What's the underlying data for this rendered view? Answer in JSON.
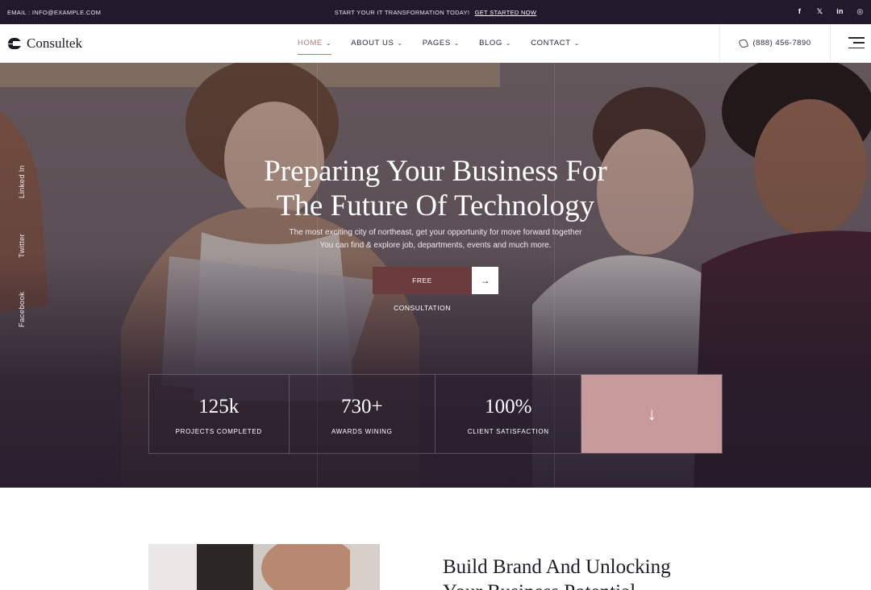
{
  "topbar": {
    "email": "EMAIL : INFO@EXAMPLE.COM",
    "promo": "START YOUR IT TRANSFORMATION TODAY!",
    "promo_link": "GET STARTED NOW",
    "social": [
      {
        "icon": "facebook-icon",
        "glyph": "f"
      },
      {
        "icon": "x-icon",
        "glyph": "𝕏"
      },
      {
        "icon": "linkedin-icon",
        "glyph": "in"
      },
      {
        "icon": "instagram-icon",
        "glyph": "◎"
      }
    ]
  },
  "nav": {
    "logo_text": "Consultek",
    "items": [
      {
        "label": "HOME",
        "active": true
      },
      {
        "label": "ABOUT US"
      },
      {
        "label": "PAGES"
      },
      {
        "label": "BLOG"
      },
      {
        "label": "CONTACT"
      }
    ],
    "chevron": "⌄",
    "phone": "(888) 456-7890"
  },
  "hero": {
    "side_social": [
      "Linked In",
      "Twitter",
      "Facebook"
    ],
    "title_line1": "Preparing Your Business For",
    "title_line2": "The Future Of Technology",
    "subtitle_line1": "The most exciting city of northeast, get your opportunity for move forward together",
    "subtitle_line2": "You can find & explore job, departments, events and much more.",
    "cta_label": "FREE CONSULTATION",
    "cta_arrow": "→",
    "stats": [
      {
        "value": "125k",
        "label": "PROJECTS COMPLETED"
      },
      {
        "value": "730+",
        "label": "AWARDS WINING"
      },
      {
        "value": "100%",
        "label": "CLIENT SATISFACTION"
      }
    ],
    "down_arrow": "↓"
  },
  "about": {
    "title_line1": "Build Brand And Unlocking",
    "title_line2": "Your Business Potential"
  },
  "colors": {
    "topbar_bg": "#201a2c",
    "accent": "#b07a78",
    "cta_bg": "#6c3b3d",
    "stat_accent": "#c99a9b"
  }
}
